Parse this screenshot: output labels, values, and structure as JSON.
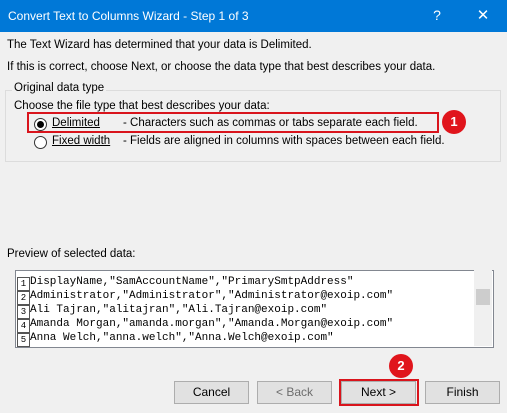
{
  "window": {
    "title": "Convert Text to Columns Wizard - Step 1 of 3",
    "help_label": "?",
    "close_label": "✕"
  },
  "intro": {
    "line1": "The Text Wizard has determined that your data is Delimited.",
    "line2": "If this is correct, choose Next, or choose the data type that best describes your data."
  },
  "group": {
    "title": "Original data type",
    "prompt": "Choose the file type that best describes your data:",
    "options": [
      {
        "label": "Delimited",
        "description": "- Characters such as commas or tabs separate each field.",
        "selected": true
      },
      {
        "label": "Fixed width",
        "description": "- Fields are aligned in columns with spaces between each field.",
        "selected": false
      }
    ]
  },
  "preview": {
    "label": "Preview of selected data:",
    "rows": [
      {
        "num": "1",
        "text": "DisplayName,\"SamAccountName\",\"PrimarySmtpAddress\""
      },
      {
        "num": "2",
        "text": "Administrator,\"Administrator\",\"Administrator@exoip.com\""
      },
      {
        "num": "3",
        "text": "Ali Tajran,\"alitajran\",\"Ali.Tajran@exoip.com\""
      },
      {
        "num": "4",
        "text": "Amanda Morgan,\"amanda.morgan\",\"Amanda.Morgan@exoip.com\""
      },
      {
        "num": "5",
        "text": "Anna Welch,\"anna.welch\",\"Anna.Welch@exoip.com\""
      }
    ]
  },
  "buttons": {
    "cancel": "Cancel",
    "back": "< Back",
    "next": "Next >",
    "finish": "Finish"
  },
  "markers": {
    "one": "1",
    "two": "2"
  },
  "colors": {
    "titlebar": "#0078d7",
    "annotation_red": "#d9141c"
  }
}
